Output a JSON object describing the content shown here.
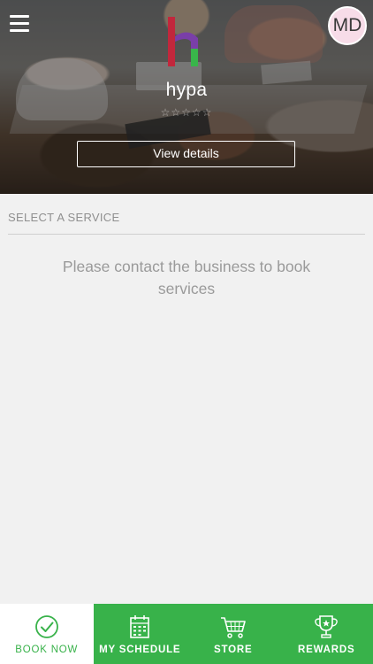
{
  "header": {
    "menu_icon": "hamburger-menu-icon",
    "avatar_initials": "MD",
    "business_name": "hypa",
    "rating_stars": "☆☆☆☆☆",
    "view_details_label": "View details",
    "logo_icon": "hypa-logo-icon"
  },
  "main": {
    "section_label": "SELECT A SERVICE",
    "empty_message": "Please contact the business to book services"
  },
  "tabbar": {
    "active_color": "#38b24a",
    "items": [
      {
        "label": "BOOK NOW",
        "icon": "checkmark-circle-icon",
        "active": true
      },
      {
        "label": "MY SCHEDULE",
        "icon": "calendar-icon",
        "active": false
      },
      {
        "label": "STORE",
        "icon": "shopping-cart-icon",
        "active": false
      },
      {
        "label": "REWARDS",
        "icon": "trophy-icon",
        "active": false
      }
    ]
  }
}
